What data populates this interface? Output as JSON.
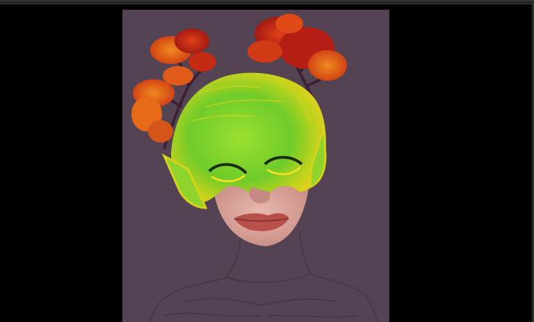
{
  "app": {
    "title": ""
  },
  "canvas": {
    "background_color": "#000000",
    "artboard_color": "#544453"
  },
  "artwork": {
    "subject": "",
    "colors": {
      "mask_green": "#7fd12a",
      "mask_yellow": "#e8d21a",
      "leaf_red": "#c42a12",
      "leaf_orange": "#e85a18",
      "skin": "#d9a59a",
      "lips": "#b8504a",
      "sketch_line": "#3e2c38"
    }
  }
}
